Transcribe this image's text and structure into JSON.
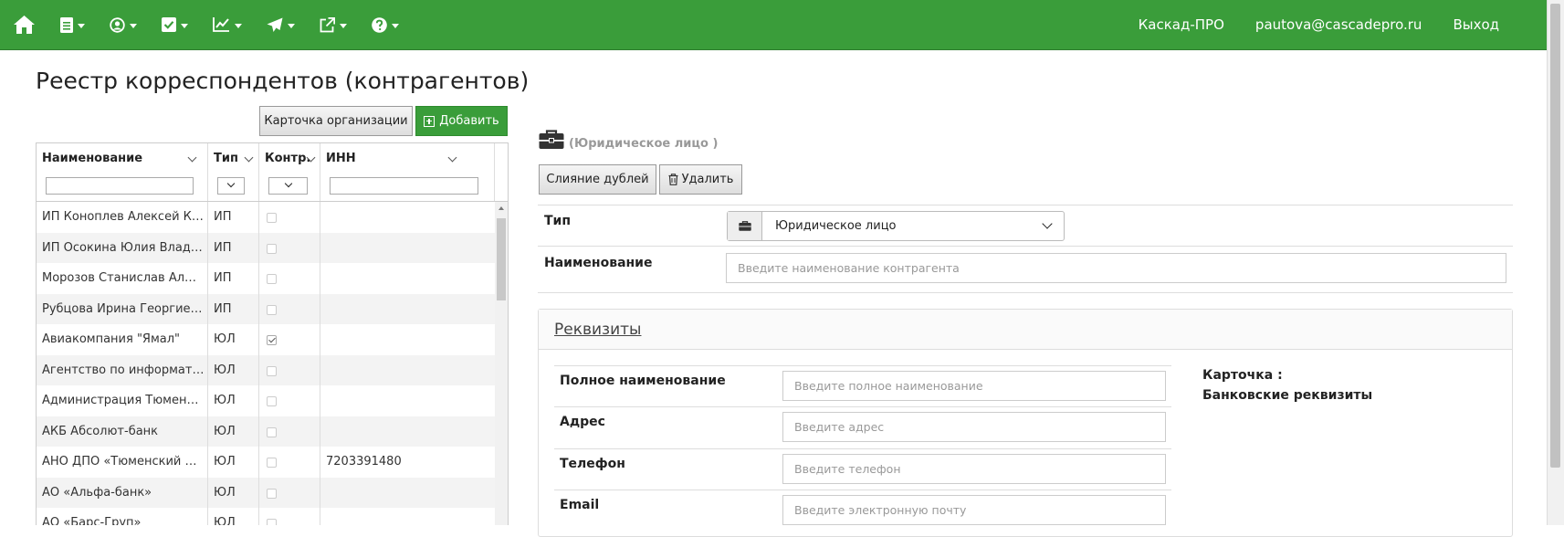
{
  "navbar": {
    "icons": [
      "home-icon",
      "document-icon",
      "user-circle-icon",
      "checkbox-icon",
      "chart-line-icon",
      "paper-plane-icon",
      "external-link-icon",
      "question-icon"
    ],
    "company": "Каскад-ПРО",
    "email": "pautova@cascadepro.ru",
    "logout": "Выход",
    "color": "#3a9d3a"
  },
  "page": {
    "title": "Реестр корреспондентов (контрагентов)"
  },
  "toolbar": {
    "card_label": "Карточка организации",
    "add_label": "Добавить"
  },
  "grid": {
    "columns": [
      {
        "label": "Наименование"
      },
      {
        "label": "Тип"
      },
      {
        "label": "Контр."
      },
      {
        "label": "ИНН"
      }
    ],
    "rows": [
      {
        "name": "ИП Коноплев Алексей К…",
        "type": "ИП",
        "contr": false,
        "inn": ""
      },
      {
        "name": "ИП Осокина Юлия Влад…",
        "type": "ИП",
        "contr": false,
        "inn": ""
      },
      {
        "name": "Морозов Станислав Ал…",
        "type": "ИП",
        "contr": false,
        "inn": ""
      },
      {
        "name": "Рубцова Ирина Георгие…",
        "type": "ИП",
        "contr": false,
        "inn": ""
      },
      {
        "name": "Авиакомпания \"Ямал\"",
        "type": "ЮЛ",
        "contr": true,
        "inn": ""
      },
      {
        "name": "Агентство по информат…",
        "type": "ЮЛ",
        "contr": false,
        "inn": ""
      },
      {
        "name": "Администрация Тюмен…",
        "type": "ЮЛ",
        "contr": false,
        "inn": ""
      },
      {
        "name": "АКБ Абсолют-банк",
        "type": "ЮЛ",
        "contr": false,
        "inn": ""
      },
      {
        "name": "АНО ДПО «Тюменский …",
        "type": "ЮЛ",
        "contr": false,
        "inn": "7203391480"
      },
      {
        "name": "АО «Альфа-банк»",
        "type": "ЮЛ",
        "contr": false,
        "inn": ""
      },
      {
        "name": "АО «Барс-Груп»",
        "type": "ЮЛ",
        "contr": false,
        "inn": ""
      }
    ]
  },
  "entity": {
    "type_label": "(Юридическое лицо )",
    "merge_label": "Слияние дублей",
    "delete_label": "Удалить"
  },
  "form": {
    "type_label": "Тип",
    "type_value": "Юридическое лицо",
    "name_label": "Наименование",
    "name_placeholder": "Введите наименование контрагента"
  },
  "requisites": {
    "title": "Реквизиты",
    "full_name_label": "Полное наименование",
    "full_name_placeholder": "Введите полное наименование",
    "address_label": "Адрес",
    "address_placeholder": "Введите адрес",
    "phone_label": "Телефон",
    "phone_placeholder": "Введите телефон",
    "email_label": "Email",
    "email_placeholder": "Введите электронную почту",
    "card_label": "Карточка :",
    "bank_label": "Банковские реквизиты"
  }
}
